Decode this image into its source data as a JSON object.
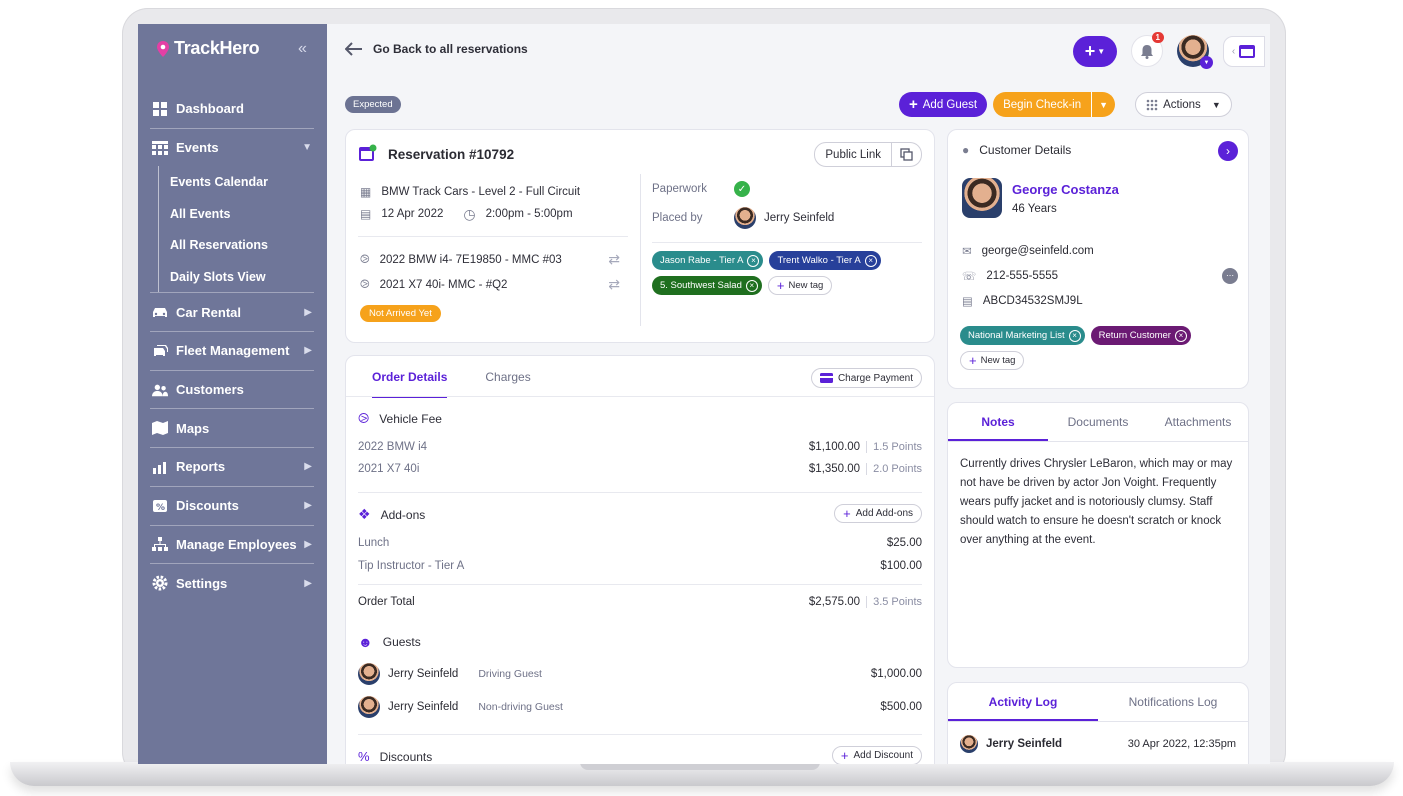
{
  "app": {
    "name": "TrackHero"
  },
  "sidebar": {
    "items": [
      {
        "label": "Dashboard"
      },
      {
        "label": "Events"
      },
      {
        "label": "Car Rental"
      },
      {
        "label": "Fleet Management"
      },
      {
        "label": "Customers"
      },
      {
        "label": "Maps"
      },
      {
        "label": "Reports"
      },
      {
        "label": "Discounts"
      },
      {
        "label": "Manage Employees"
      },
      {
        "label": "Settings"
      }
    ],
    "events_sub": [
      "Events Calendar",
      "All Events",
      "All Reservations",
      "Daily Slots View"
    ]
  },
  "header": {
    "back_label": "Go Back to all reservations",
    "notification_count": "1"
  },
  "status_pill": "Expected",
  "actions": {
    "add_guest": "Add Guest",
    "begin_checkin": "Begin Check-in",
    "actions": "Actions"
  },
  "reservation": {
    "title": "Reservation #10792",
    "public_link": "Public Link",
    "event": "BMW Track Cars - Level 2 - Full Circuit",
    "date": "12 Apr 2022",
    "time": "2:00pm  - 5:00pm",
    "vehicles": [
      "2022 BMW i4- 7E19850 - MMC #03",
      "2021 X7 40i- MMC - #Q2"
    ],
    "arrival_status": "Not Arrived Yet",
    "paperwork_label": "Paperwork",
    "placed_by_label": "Placed by",
    "placed_by": "Jerry Seinfeld",
    "tags": [
      {
        "label": "Jason Rabe - Tier A",
        "color": "#2a8c8c"
      },
      {
        "label": "Trent Walko - Tier A",
        "color": "#27409a"
      },
      {
        "label": "5. Southwest Salad",
        "color": "#1f6f1f"
      }
    ],
    "new_tag": "New tag"
  },
  "order": {
    "tabs": [
      "Order Details",
      "Charges"
    ],
    "charge_payment": "Charge Payment",
    "vehicle_fee_title": "Vehicle Fee",
    "vehicle_fees": [
      {
        "name": "2022 BMW i4",
        "price": "$1,100.00",
        "points": "1.5 Points"
      },
      {
        "name": "2021 X7 40i",
        "price": "$1,350.00",
        "points": "2.0 Points"
      }
    ],
    "addons_title": "Add-ons",
    "add_addons": "Add Add-ons",
    "addons": [
      {
        "name": "Lunch",
        "price": "$25.00"
      },
      {
        "name": "Tip Instructor - Tier A",
        "price": "$100.00"
      }
    ],
    "total_label": "Order Total",
    "total": "$2,575.00",
    "total_points": "3.5 Points",
    "guests_title": "Guests",
    "guests": [
      {
        "name": "Jerry Seinfeld",
        "type": "Driving Guest",
        "price": "$1,000.00"
      },
      {
        "name": "Jerry Seinfeld",
        "type": "Non-driving Guest",
        "price": "$500.00"
      }
    ],
    "discounts_title": "Discounts",
    "add_discount": "Add Discount"
  },
  "customer": {
    "title": "Customer Details",
    "name": "George Costanza",
    "age": "46 Years",
    "email": "george@seinfeld.com",
    "phone": "212-555-5555",
    "license": "ABCD34532SMJ9L",
    "tags": [
      {
        "label": "National Marketing List",
        "color": "#2a8c8c"
      },
      {
        "label": "Return Customer",
        "color": "#6b1a73"
      }
    ],
    "new_tag": "New tag"
  },
  "notes": {
    "tabs": [
      "Notes",
      "Documents",
      "Attachments"
    ],
    "text": "Currently drives Chrysler LeBaron, which may or may not have be driven by actor Jon Voight. Frequently wears puffy jacket and is notoriously clumsy.  Staff should watch to ensure he doesn't scratch or knock over anything at the event."
  },
  "activity": {
    "tabs": [
      "Activity Log",
      "Notifications Log"
    ],
    "entries": [
      {
        "user": "Jerry Seinfeld",
        "time": "30 Apr 2022, 12:35pm"
      }
    ]
  },
  "colors": {
    "accent": "#5b21d8",
    "sidebar": "#6f7699",
    "orange": "#f6a21b"
  }
}
